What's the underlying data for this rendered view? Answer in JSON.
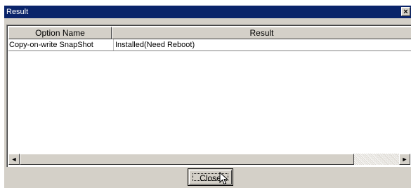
{
  "window": {
    "title": "Result",
    "close_glyph": "×"
  },
  "table": {
    "columns": [
      "Option Name",
      "Result"
    ],
    "rows": [
      {
        "option": "Copy-on-write SnapShot",
        "result": "Installed(Need Reboot)"
      }
    ]
  },
  "scrollbar": {
    "left_arrow": "◄",
    "right_arrow": "►"
  },
  "footer": {
    "close_label": "Close"
  },
  "colors": {
    "titlebar": "#0a246a",
    "face": "#d4d0c8"
  }
}
